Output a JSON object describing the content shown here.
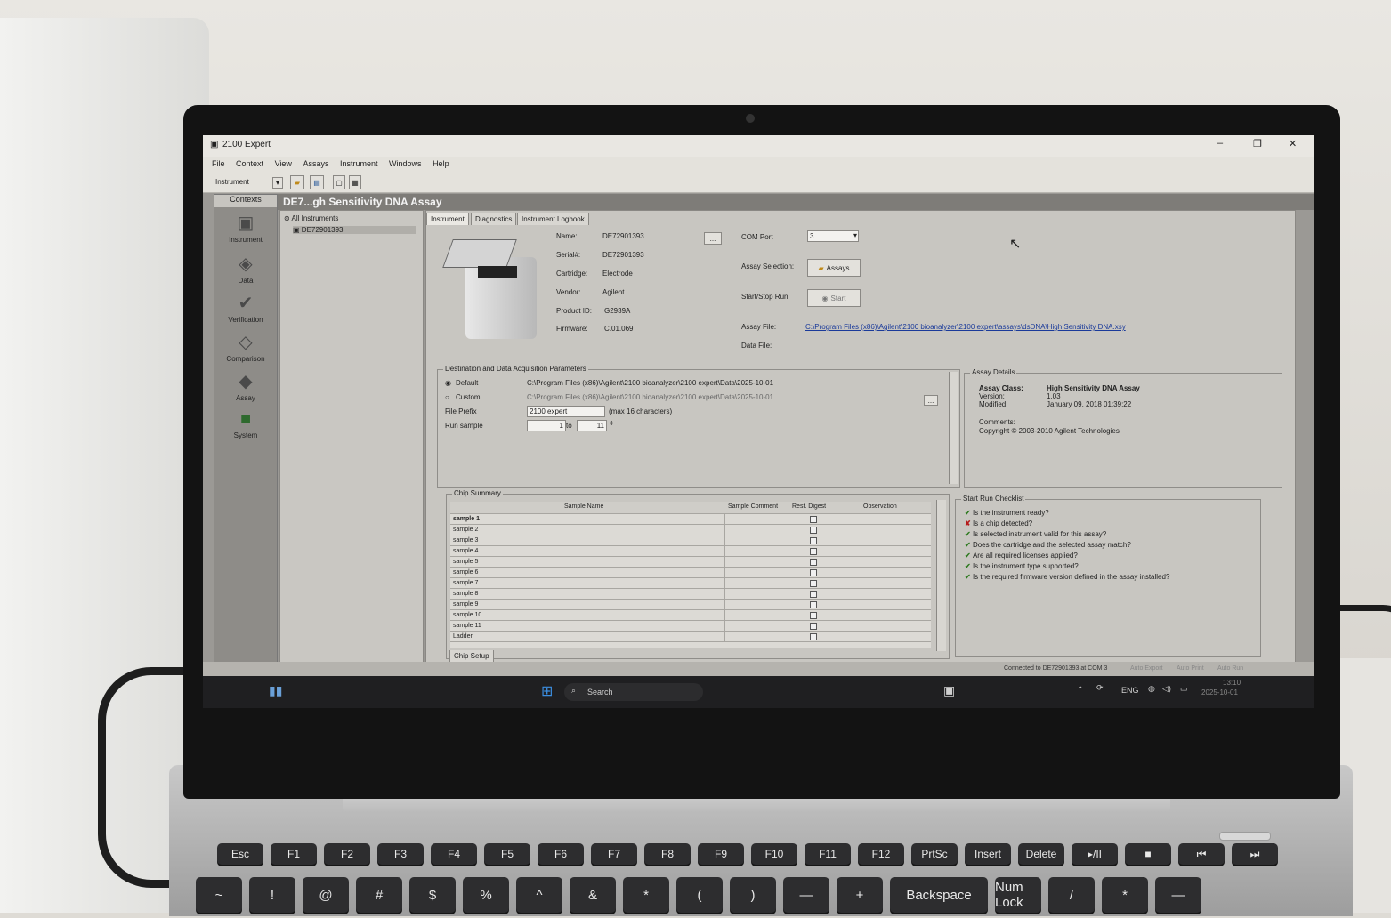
{
  "window": {
    "title": "2100 Expert",
    "controls": [
      "–",
      "❐",
      "✕"
    ]
  },
  "menu": [
    "File",
    "Context",
    "View",
    "Assays",
    "Instrument",
    "Windows",
    "Help"
  ],
  "toolbar": {
    "context_select": "Instrument"
  },
  "contexts": {
    "header": "Contexts",
    "items": [
      "Instrument",
      "Data",
      "Verification",
      "Comparison",
      "Assay",
      "System"
    ]
  },
  "title_strip": "DE7...gh Sensitivity DNA Assay",
  "tree": {
    "root": "All Instruments",
    "child": "DE72901393"
  },
  "tabs": [
    "Instrument",
    "Diagnostics",
    "Instrument Logbook"
  ],
  "instrument": {
    "name_label": "Name:",
    "name_value": "DE72901393",
    "browse": "...",
    "serial_label": "Serial#:",
    "serial_value": "DE72901393",
    "cartridge_label": "Cartridge:",
    "cartridge_value": "Electrode",
    "vendor_label": "Vendor:",
    "vendor_value": "Agilent",
    "product_label": "Product ID:",
    "product_value": "G2939A",
    "firmware_label": "Firmware:",
    "firmware_value": "C.01.069",
    "com_label": "COM Port",
    "com_value": "3",
    "assay_sel_label": "Assay Selection:",
    "assays_btn": "Assays",
    "startstop_label": "Start/Stop Run:",
    "start_btn": "Start",
    "assay_file_label": "Assay File:",
    "assay_file_value": "C:\\Program Files (x86)\\Agilent\\2100 bioanalyzer\\2100 expert\\assays\\dsDNA\\High Sensitivity DNA.xsy",
    "data_file_label": "Data File:"
  },
  "destination": {
    "title": "Destination and Data Acquisition Parameters",
    "default_label": "Default",
    "default_path": "C:\\Program Files (x86)\\Agilent\\2100 bioanalyzer\\2100 expert\\Data\\2025-10-01",
    "custom_label": "Custom",
    "custom_path": "C:\\Program Files (x86)\\Agilent\\2100 bioanalyzer\\2100 expert\\Data\\2025-10-01",
    "browse": "...",
    "prefix_label": "File Prefix",
    "prefix_value": "2100 expert",
    "prefix_hint": "(max 16 characters)",
    "run_label": "Run sample",
    "run_from": "1",
    "run_to_label": "to",
    "run_to": "11"
  },
  "assay_details": {
    "title": "Assay Details",
    "class_label": "Assay Class:",
    "class_value": "High Sensitivity DNA Assay",
    "version_label": "Version:",
    "version_value": "1.03",
    "modified_label": "Modified:",
    "modified_value": "January 09, 2018 01:39:22",
    "comments_label": "Comments:",
    "copyright": "Copyright © 2003-2010 Agilent Technologies"
  },
  "chip_summary": {
    "title": "Chip Summary",
    "columns": [
      "Sample Name",
      "Sample Comment",
      "Rest. Digest",
      "Observation"
    ],
    "rows": [
      "sample 1",
      "sample 2",
      "sample 3",
      "sample 4",
      "sample 5",
      "sample 6",
      "sample 7",
      "sample 8",
      "sample 9",
      "sample 10",
      "sample 11",
      "Ladder"
    ],
    "bottom_tab": "Chip Setup"
  },
  "checklist": {
    "title": "Start Run Checklist",
    "items": [
      {
        "text": "Is the instrument ready?",
        "ok": true
      },
      {
        "text": "Is a chip detected?",
        "ok": false
      },
      {
        "text": "Is selected instrument valid for this assay?",
        "ok": true
      },
      {
        "text": "Does the cartridge and the selected assay match?",
        "ok": true
      },
      {
        "text": "Are all required licenses applied?",
        "ok": true
      },
      {
        "text": "Is the instrument type supported?",
        "ok": true
      },
      {
        "text": "Is the required firmware version defined in the assay installed?",
        "ok": true
      }
    ]
  },
  "status": {
    "connection": "Connected to DE72901393 at COM 3",
    "auto_export": "Auto Export",
    "auto_print": "Auto Print",
    "auto_run": "Auto Run"
  },
  "taskbar": {
    "search": "Search",
    "lang": "ENG",
    "time": "13:10",
    "date": "2025-10-01"
  },
  "keyboard": {
    "fn_row": [
      "Esc",
      "F1",
      "F2",
      "F3",
      "F4",
      "F5",
      "F6",
      "F7",
      "F8",
      "F9",
      "F10",
      "F11",
      "F12",
      "PrtSc",
      "Insert",
      "Delete",
      "▸/II",
      "■",
      "⏮",
      "⏭"
    ],
    "num_row": [
      "~",
      "!",
      "@",
      "#",
      "$",
      "%",
      "^",
      "&",
      "*",
      "(",
      ")",
      "—",
      "+",
      "Backspace",
      "Num Lock",
      "/",
      "*",
      "—"
    ]
  }
}
